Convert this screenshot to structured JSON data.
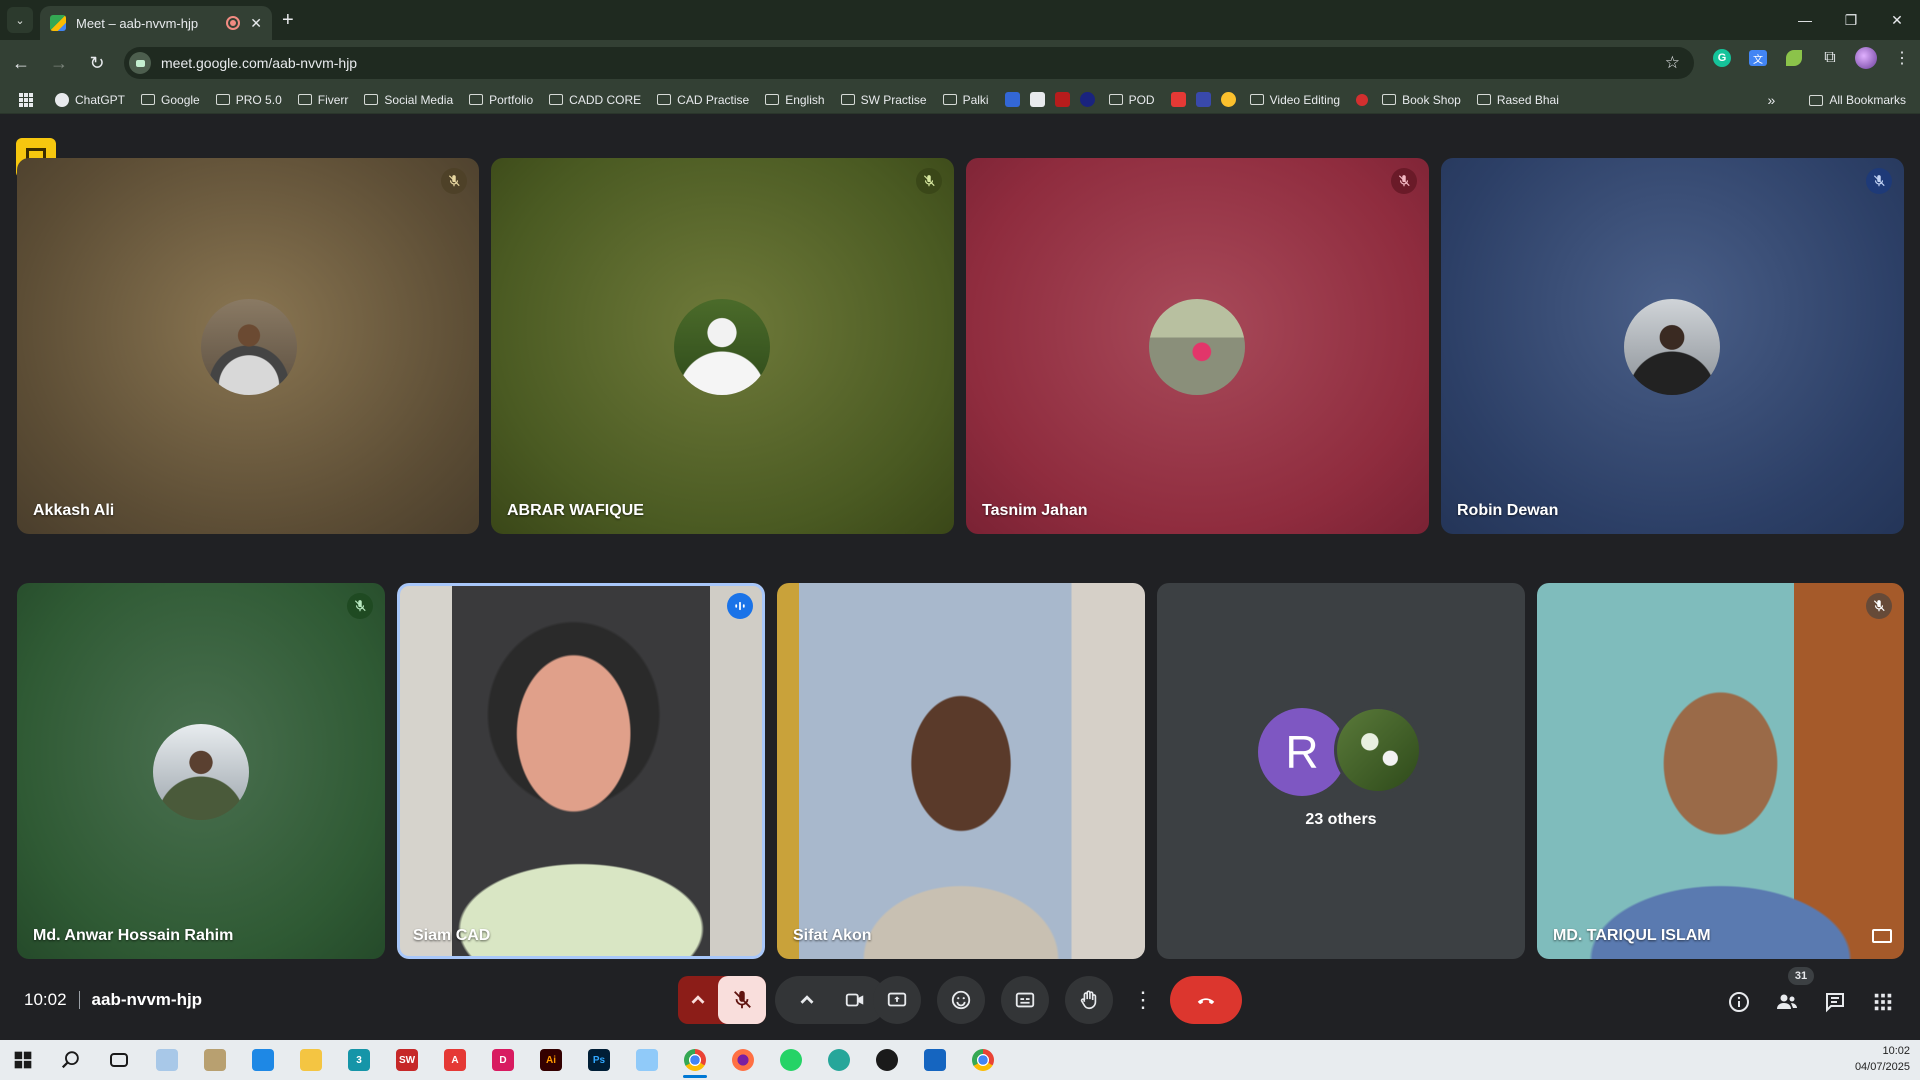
{
  "browser": {
    "tab_title": "Meet – aab-nvvm-hjp",
    "url": "meet.google.com/aab-nvvm-hjp",
    "bookmarks": [
      "ChatGPT",
      "Google",
      "PRO 5.0",
      "Fiverr",
      "Social Media",
      "Portfolio",
      "CADD CORE",
      "CAD Practise",
      "English",
      "SW Practise",
      "Palki",
      "POD",
      "Video Editing",
      "Book Shop",
      "Rased Bhai"
    ],
    "all_bookmarks": "All Bookmarks"
  },
  "meeting": {
    "time": "10:02",
    "code": "aab-nvvm-hjp",
    "people_count": "31"
  },
  "participants_top": [
    {
      "name": "Akkash Ali",
      "mic": "muted"
    },
    {
      "name": "ABRAR WAFIQUE",
      "mic": "muted"
    },
    {
      "name": "Tasnim Jahan",
      "mic": "muted"
    },
    {
      "name": "Robin Dewan",
      "mic": "muted"
    }
  ],
  "participants_bottom": [
    {
      "name": "Md. Anwar Hossain Rahim",
      "mic": "muted"
    },
    {
      "name": "Siam CAD",
      "mic": "speaking"
    },
    {
      "name": "Sifat Akon",
      "mic": "on"
    },
    {
      "name": "MD. TARIQUL ISLAM",
      "mic": "muted"
    }
  ],
  "others": {
    "initial": "R",
    "label": "23 others"
  },
  "colors": {
    "tile_akkash": "#6d5b40",
    "tile_abrar": "#4c5a22",
    "tile_tasnim": "#8f2c3e",
    "tile_robin": "#2c3f66",
    "tile_anwar": "#2f5a34",
    "leave_button": "#dc362e",
    "speaking_outline": "#a8c7fa"
  },
  "taskbar": {
    "time": "10:02",
    "date": "04/07/2025",
    "icons": [
      "start-icon",
      "search-icon",
      "task-view-icon",
      "file-explorer-icon",
      "calculator-icon",
      "folder-icon",
      "3dmax-icon",
      "solidworks-icon",
      "autocad-icon",
      "designer-icon",
      "illustrator-icon",
      "photoshop-icon",
      "notepad-icon",
      "chrome-icon",
      "firefox-icon",
      "whatsapp-icon",
      "app-icon",
      "red-app-icon",
      "solidworks-alt-icon",
      "chrome-alt-icon"
    ]
  }
}
